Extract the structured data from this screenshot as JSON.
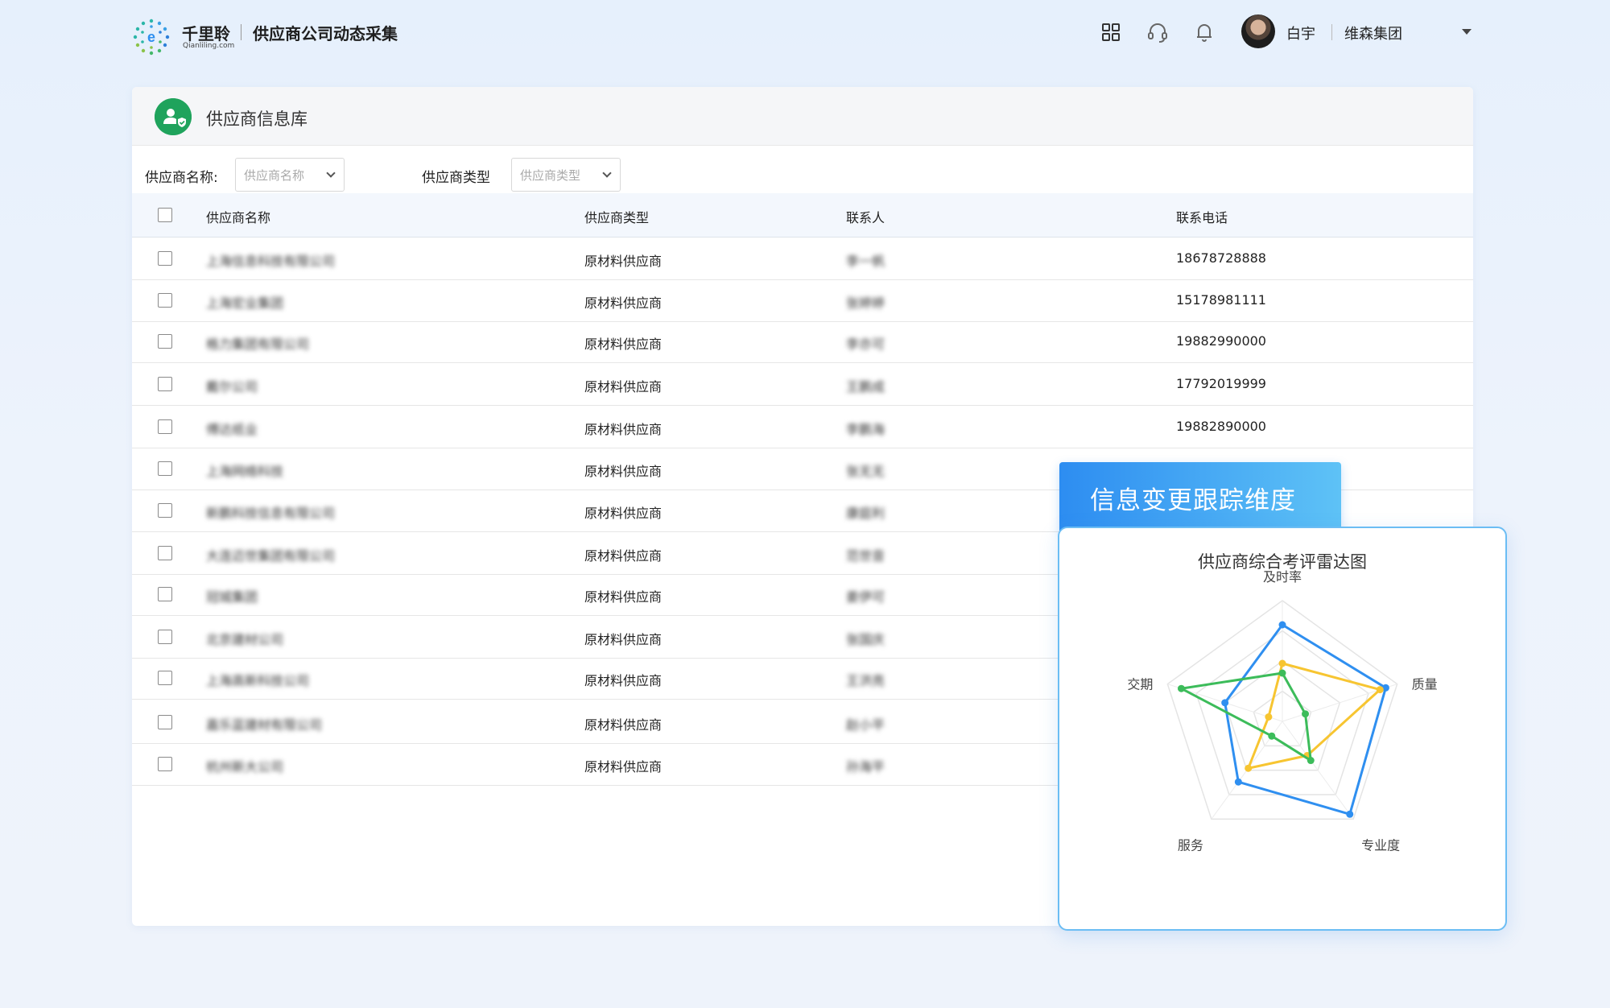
{
  "header": {
    "brand": "千里聆",
    "brand_sub": "Qianliling.com",
    "app_title": "供应商公司动态采集",
    "user": "白宇",
    "org": "维森集团"
  },
  "panel": {
    "title": "供应商信息库",
    "filters": {
      "name_label": "供应商名称:",
      "name_placeholder": "供应商名称",
      "type_label": "供应商类型",
      "type_placeholder": "供应商类型"
    },
    "columns": [
      "供应商名称",
      "供应商类型",
      "联系人",
      "联系电话"
    ],
    "rows": [
      {
        "name": "上海信息科技有限公司",
        "type": "原材料供应商",
        "contact": "李一帆",
        "phone": "18678728888"
      },
      {
        "name": "上海宏业集团",
        "type": "原材料供应商",
        "contact": "张婷婷",
        "phone": "15178981111"
      },
      {
        "name": "格力集团有限公司",
        "type": "原材料供应商",
        "contact": "李亦可",
        "phone": "19882990000"
      },
      {
        "name": "戴尔公司",
        "type": "原材料供应商",
        "contact": "王鹏成",
        "phone": "17792019999"
      },
      {
        "name": "傅达纸业",
        "type": "原材料供应商",
        "contact": "李鹏海",
        "phone": "19882890000"
      },
      {
        "name": "上海网络科技",
        "type": "原材料供应商",
        "contact": "张无无",
        "phone": ""
      },
      {
        "name": "新鹏科技信息有限公司",
        "type": "原材料供应商",
        "contact": "康庭利",
        "phone": ""
      },
      {
        "name": "大连迈世集团有限公司",
        "type": "原材料供应商",
        "contact": "范世音",
        "phone": ""
      },
      {
        "name": "冠城集团",
        "type": "原材料供应商",
        "contact": "姜伊可",
        "phone": ""
      },
      {
        "name": "北京建材公司",
        "type": "原材料供应商",
        "contact": "张国庆",
        "phone": ""
      },
      {
        "name": "上海高新科技公司",
        "type": "原材料供应商",
        "contact": "王洪亮",
        "phone": ""
      },
      {
        "name": "嘉乐蓝建材有限公司",
        "type": "原材料供应商",
        "contact": "赵小平",
        "phone": ""
      },
      {
        "name": "杭州新大公司",
        "type": "原材料供应商",
        "contact": "孙海平",
        "phone": ""
      }
    ]
  },
  "overlay": {
    "tab_title": "信息变更跟踪维度",
    "card_title": "供应商综合考评雷达图"
  },
  "chart_data": {
    "type": "radar",
    "title": "供应商综合考评雷达图",
    "axes": [
      "及时率",
      "质量",
      "专业度",
      "服务",
      "交期"
    ],
    "max": 100,
    "series": [
      {
        "values": [
          80,
          90,
          95,
          62,
          50
        ],
        "color": "#2f8ff0"
      },
      {
        "values": [
          48,
          85,
          35,
          48,
          12
        ],
        "color": "#f7c531"
      },
      {
        "values": [
          40,
          20,
          40,
          15,
          88
        ],
        "color": "#3cbc5a"
      }
    ],
    "grid_levels": 4
  },
  "colors": {
    "accent_green": "#1fa35c",
    "tab_gradient_start": "#2d8df1",
    "tab_gradient_end": "#5ec2f6"
  }
}
